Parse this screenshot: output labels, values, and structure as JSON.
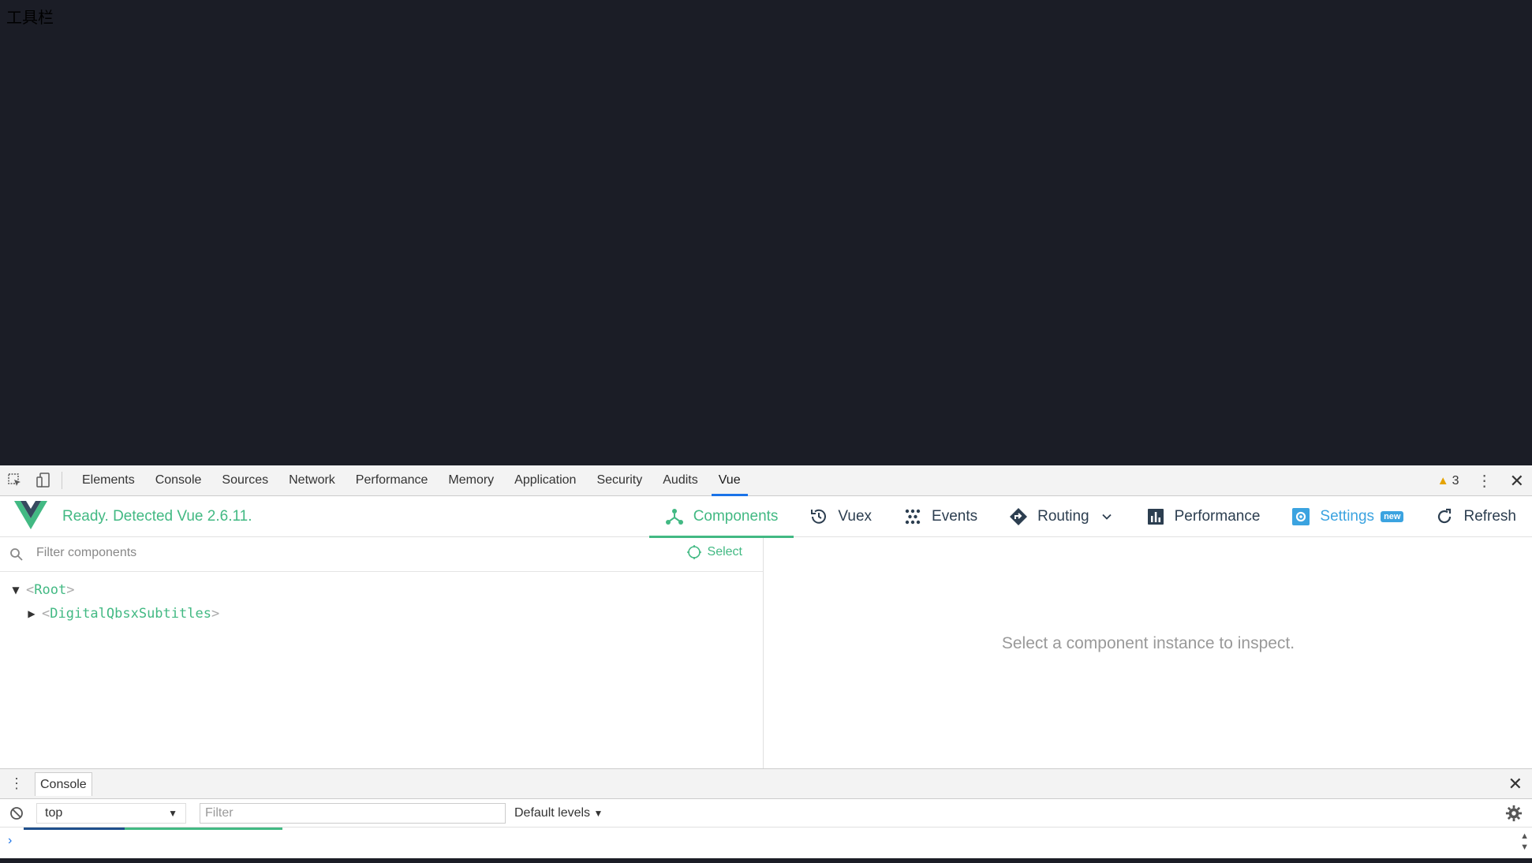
{
  "page": {
    "label": "工具栏"
  },
  "devtools": {
    "tabs": [
      "Elements",
      "Console",
      "Sources",
      "Network",
      "Performance",
      "Memory",
      "Application",
      "Security",
      "Audits",
      "Vue"
    ],
    "active_tab": "Vue",
    "warning_count": "3"
  },
  "vue": {
    "status": "Ready. Detected Vue 2.6.11.",
    "nav": {
      "components": "Components",
      "vuex": "Vuex",
      "events": "Events",
      "routing": "Routing",
      "performance": "Performance",
      "settings": "Settings",
      "settings_badge": "new",
      "refresh": "Refresh"
    },
    "filter_placeholder": "Filter components",
    "select_label": "Select",
    "tree": {
      "root": "Root",
      "child": "DigitalQbsxSubtitles"
    },
    "inspect_message": "Select a component instance to inspect."
  },
  "drawer": {
    "tab": "Console",
    "context": "top",
    "filter_placeholder": "Filter",
    "levels": "Default levels",
    "prompt": "›"
  },
  "colors": {
    "vue_green": "#42b983",
    "vue_dark": "#35495e",
    "settings_blue": "#3ba3e0",
    "page_bg": "#1b1d26"
  }
}
